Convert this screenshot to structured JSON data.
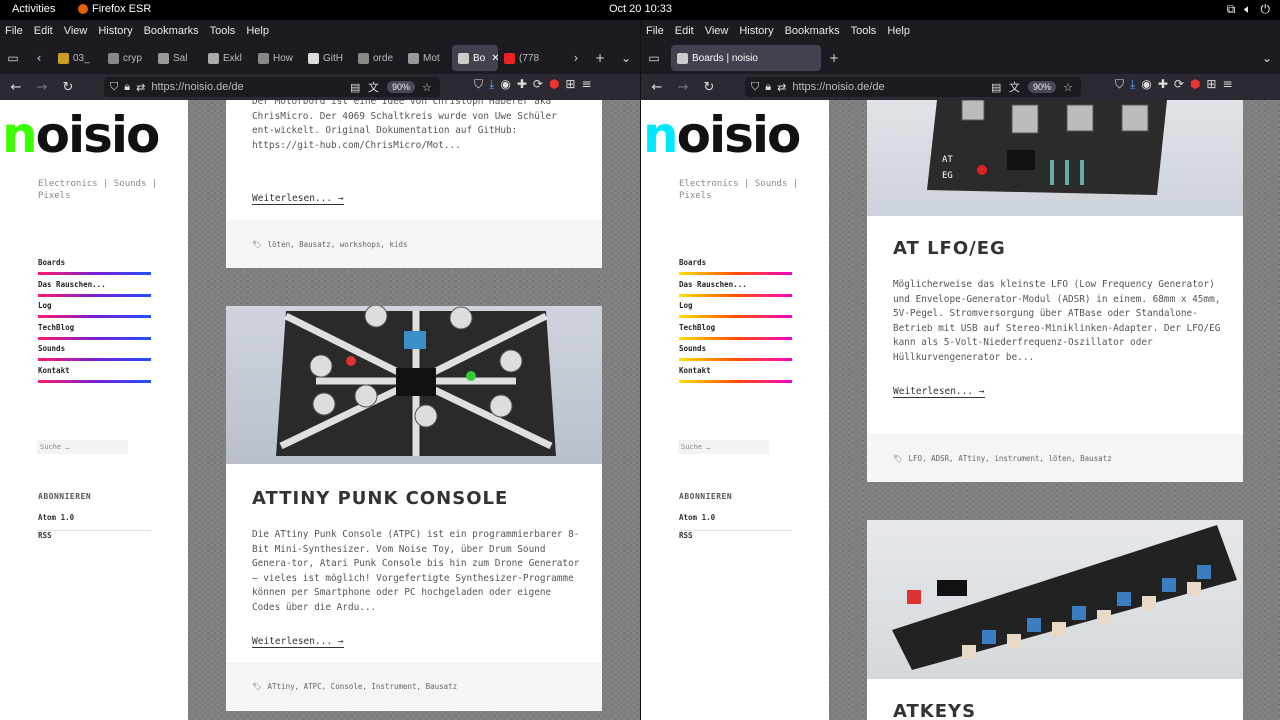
{
  "topbar": {
    "activities": "Activities",
    "app": "Firefox ESR",
    "clock": "Oct 20  10:33"
  },
  "left": {
    "menu": [
      "File",
      "Edit",
      "View",
      "History",
      "Bookmarks",
      "Tools",
      "Help"
    ],
    "tabs": [
      {
        "label": "03_",
        "color": "#c8a020"
      },
      {
        "label": "cryp",
        "color": "#888"
      },
      {
        "label": "Sal",
        "color": "#999"
      },
      {
        "label": "Exkl",
        "color": "#aaa"
      },
      {
        "label": "How",
        "color": "#888"
      },
      {
        "label": "GitH",
        "color": "#ddd"
      },
      {
        "label": "orde",
        "color": "#888"
      },
      {
        "label": "Mot",
        "color": "#999"
      },
      {
        "label": "Bo",
        "color": "#ccc"
      },
      {
        "label": "(778",
        "color": "#e22"
      }
    ],
    "url": "https://noisio.de/de",
    "zoom": "90%",
    "logo_a": "n",
    "logo_b": "oisio",
    "tagline": "Electronics | Sounds | Pixels",
    "nav": [
      "Boards",
      "Das Rauschen...",
      "Log",
      "TechBlog",
      "Sounds",
      "Kontakt"
    ],
    "search_placeholder": "Suche …",
    "subscribe": "ABONNIEREN",
    "feed1": "Atom 1.0",
    "feed2": "RSS",
    "post1_text": "Der Motörbörd ist eine Idee von Christoph Haberer aka ChrisMicro. Der 4069 Schaltkreis wurde von Uwe Schüler ent-wickelt. Original Dokumentation auf GitHub: https://git-hub.com/ChrisMicro/Mot...",
    "more": "Weiterlesen... →",
    "post1_tags": "löten, Bausatz, workshops, kids",
    "post2_title": "ATTINY PUNK CONSOLE",
    "post2_text": "Die ATtiny Punk Console (ATPC) ist ein programmierbarer 8-Bit Mini-Synthesizer. Vom Noise Toy, über Drum Sound Genera-tor, Atari Punk Console bis hin zum Drone Generator – vieles ist möglich! Vorgefertigte Synthesizer-Programme können per Smartphone oder PC hochgeladen oder eigene Codes über die Ardu...",
    "post2_tags": "ATtiny, ATPC, Console, Instrument, Bausatz"
  },
  "right": {
    "menu": [
      "File",
      "Edit",
      "View",
      "History",
      "Bookmarks",
      "Tools",
      "Help"
    ],
    "tab": "Boards | noisio",
    "url": "https://noisio.de/de",
    "zoom": "90%",
    "tagline": "Electronics | Sounds | Pixels",
    "nav": [
      "Boards",
      "Das Rauschen...",
      "Log",
      "TechBlog",
      "Sounds",
      "Kontakt"
    ],
    "search_placeholder": "Suche …",
    "subscribe": "ABONNIEREN",
    "feed1": "Atom 1.0",
    "feed2": "RSS",
    "post1_title": "AT LFO/EG",
    "post1_text": "Möglicherweise das kleinste LFO (Low Frequency Generator) und Envelope-Generator-Modul (ADSR) in einem. 68mm x 45mm, 5V-Pegel. Stromversorgung über ATBase oder Standalone-Betrieb mit USB auf Stereo-Miniklinken-Adapter. Der LFO/EG kann als 5-Volt-Niederfrequenz-Oszillator oder Hüllkurvengenerator be...",
    "more": "Weiterlesen... →",
    "post1_tags": "LFO, ADSR, ATtiny, instrument, löten, Bausatz",
    "post2_title": "ATKEYS"
  }
}
